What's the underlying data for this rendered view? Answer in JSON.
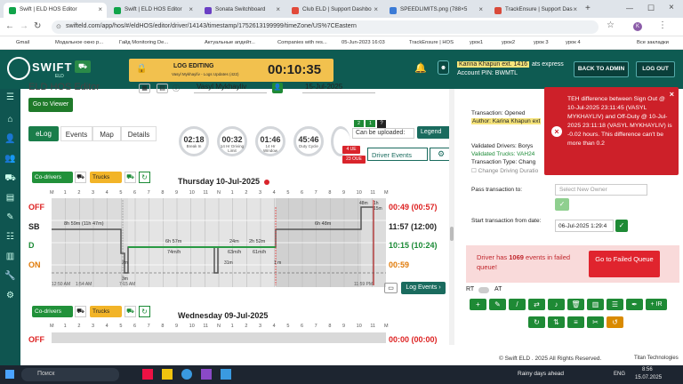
{
  "browser": {
    "tabs": [
      {
        "title": "Swift | ELD HOS Editor",
        "color": "#10a44a"
      },
      {
        "title": "Swift | ELD HOS Editor",
        "color": "#10a44a"
      },
      {
        "title": "Sonata Switchboard",
        "color": "#6a3fc4"
      },
      {
        "title": "Club ELD | Support Dashbo",
        "color": "#e24a3a"
      },
      {
        "title": "SPEEDLIMITS.png (788×5",
        "color": "#3b7bd6"
      },
      {
        "title": "TrackEnsure | Support Das",
        "color": "#d94a3a"
      }
    ],
    "url": "swifteld.com/app/hos/#/eldHOS/editor/driver/14143/timestamp/1752613199999/timeZone/US%7CEastern",
    "bookmarks": [
      "Gmail",
      "Модальное окно р...",
      "Гайд Monitoring De...",
      "Актуальные апдейт...",
      "Companies with res...",
      "05-Jun-2023 16:03",
      "TrackEnsure | HOS",
      "урок1",
      "урок2",
      "урок 3",
      "урок 4",
      "Все закладки"
    ]
  },
  "header": {
    "logo": "SWIFT",
    "logo_sub": "ELD",
    "log_editing": "LOG EDITING",
    "driver_sub": "Vasyl Mykhaylív - Logs Updates (422)",
    "timer": "00:10:35",
    "user_name": "Karina Khapun ext. 1416",
    "user_suffix": "ats express",
    "pin": "Account PIN: BWMTL",
    "back_admin": "BACK TO ADMIN",
    "logout": "LOG OUT"
  },
  "editor": {
    "title": "ELD HOS Editor",
    "driver": "Vasyl Mykhayliv",
    "date": "15-Jul-2025",
    "go_viewer": "Go to Viewer",
    "tabs": [
      "eLog",
      "Events",
      "Map",
      "Details"
    ],
    "gauges": [
      {
        "value": "02:18",
        "label": "Break In"
      },
      {
        "value": "00:32",
        "label": "14 Hr Driving Limit"
      },
      {
        "value": "01:46",
        "label": "14 Hr Window"
      },
      {
        "value": "45:46",
        "label": "Duty Cycle"
      }
    ],
    "can_upload": "Can be uploaded:",
    "legend": "Legend",
    "driver_events": "Driver Events",
    "badges": [
      "4 UE",
      "23 OUE"
    ],
    "small_badges": [
      "2",
      "1"
    ],
    "codrivers": "Co-drivers",
    "trucks": "Trucks",
    "day1": "Thursday 10-Jul-2025",
    "day2": "Wednesday 09-Jul-2025",
    "rows": [
      "OFF",
      "SB",
      "D",
      "ON"
    ],
    "totals": [
      "00:49 (00:57)",
      "11:57 (12:00)",
      "10:15 (10:24)",
      "00:59"
    ],
    "day2_off_total": "00:00 (00:00)",
    "hour_labels": [
      "M",
      "1",
      "2",
      "3",
      "4",
      "5",
      "6",
      "7",
      "8",
      "9",
      "10",
      "11",
      "N",
      "1",
      "2",
      "3",
      "4",
      "5",
      "6",
      "7",
      "8",
      "9",
      "10",
      "11",
      "M"
    ],
    "segment_labels": [
      "8h 59m (11h 47m)",
      "6h 57m",
      "74m/h",
      "24m",
      "2h 52m",
      "63m/h",
      "61m/h",
      "6h 48m",
      "48m",
      "1h 15m",
      "2m",
      "3m",
      "31m",
      "1 m"
    ],
    "time_labels": [
      "12:50 AM",
      "1:54 AM",
      "7:15 AM",
      "11:59 PM"
    ],
    "log_events": "Log Events"
  },
  "panel": {
    "transaction": "Transaction: Opened",
    "author": "Author: Karina Khapun ext",
    "validated_drivers": "Validated Drivers: Borys",
    "validated_trucks": "Validated Trucks: VAH24",
    "transaction_type": "Transaction Type: Chang",
    "change_duration": "Change Driving Duratio",
    "pass_to": "Pass transaction to:",
    "owner_placeholder": "Select New Owner",
    "start_label": "Start transaction from date:",
    "start_date": "06-Jul-2025 1:29:4",
    "queue_text_pre": "Driver has ",
    "queue_count": "1069",
    "queue_text_post": " events in failed queue!",
    "failed_queue": "Go to Failed Queue",
    "rt": "RT",
    "at": "AT",
    "ir": "+ IR"
  },
  "toast": {
    "text": "TEH difference between Sign Out @ 10-Jul-2025 23:11:45 (VASYL MYKHAYLIV) and Off-Duty @ 10-Jul-2025 23:11:18 (VASYL MYKHAYLIV) is -0.02 hours. This difference can't be more than 0.2"
  },
  "footer": {
    "copyright": "© Swift ELD . 2025 All Rights Reserved.",
    "powered": "Titan Technologies"
  },
  "taskbar": {
    "search": "Поиск",
    "weather": "Rainy days ahead",
    "lang": "ENG",
    "time": "8:56",
    "date": "15.07.2025"
  }
}
